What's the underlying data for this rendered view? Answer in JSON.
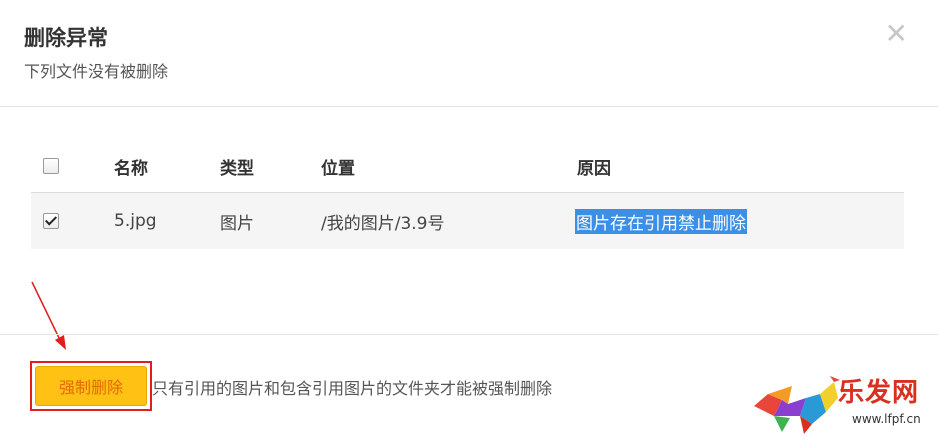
{
  "dialog": {
    "title": "删除异常",
    "subtitle": "下列文件没有被删除",
    "close_glyph": "✕"
  },
  "table": {
    "headers": [
      "名称",
      "类型",
      "位置",
      "原因"
    ],
    "rows": [
      {
        "checked": true,
        "name": "5.jpg",
        "type": "图片",
        "location": "/我的图片/3.9号",
        "reason": "图片存在引用禁止删除"
      }
    ]
  },
  "footer": {
    "force_delete_label": "强制删除",
    "hint": "只有引用的图片和包含引用图片的文件夹才能被强制删除"
  },
  "watermark": {
    "brand": "乐发网",
    "url": "www.lfpf.cn"
  },
  "colors": {
    "button_bg": "#ffc114",
    "button_text": "#e56a00",
    "highlight": "#3b8fe6",
    "annotation_red": "#e11d1d"
  }
}
